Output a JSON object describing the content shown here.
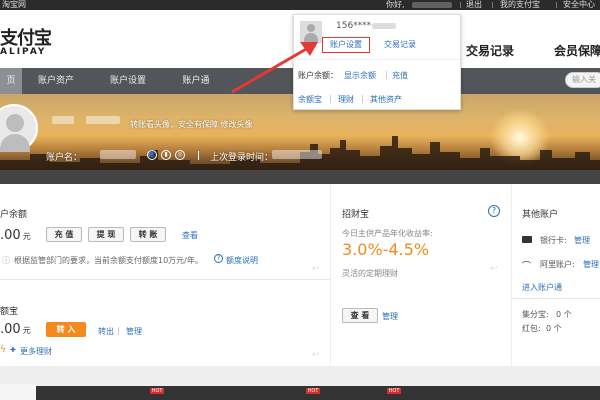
{
  "topbar": {
    "left": "淘宝网",
    "greeting": "你好,",
    "logout": "退出",
    "my_alipay": "我的支付宝",
    "security_center": "安全中心"
  },
  "header": {
    "logo": "支付宝",
    "logo_sub": "ALIPAY",
    "nav_transactions": "交易记录",
    "nav_member": "会员保障"
  },
  "tabs": [
    {
      "label": "页",
      "active": true
    },
    {
      "label": "账户资产"
    },
    {
      "label": "账户设置"
    },
    {
      "label": "账户通"
    }
  ],
  "search": {
    "placeholder": "输入关"
  },
  "banner": {
    "avatar_hint": "转账看头像，安全有保障 修改头像",
    "account_name_label": "账户名：",
    "last_login_label": "上次登录时间："
  },
  "popup": {
    "account": "156****",
    "settings": "账户设置",
    "records": "交易记录",
    "balance_label": "账户余额：",
    "show_balance": "显示余额",
    "recharge": "充值",
    "yuebao": "余额宝",
    "licai": "理财",
    "other_assets": "其他资产"
  },
  "balance_card": {
    "title": "户余额",
    "amount": ".00",
    "unit": "元",
    "btn_recharge": "充 值",
    "btn_withdraw": "提 现",
    "btn_transfer": "转 账",
    "view": "查看",
    "note": "根据监管部门的要求，当前余额支付额度10万元/年。",
    "quota_link": "额度说明"
  },
  "yuebao_card": {
    "title": "额宝",
    "amount": ".00",
    "unit": "元",
    "btn_in": "转 入",
    "out": "转出",
    "manage": "管理",
    "more": "更多理财"
  },
  "zhaocaibao": {
    "title": "招财宝",
    "help": "?",
    "subtitle": "今日主供产品年化收益率:",
    "rate": "3.0%-4.5%",
    "desc": "灵活的定期理财",
    "view_btn": "查 看",
    "manage": "管理"
  },
  "other_accounts": {
    "title": "其他账户",
    "bank_label": "银行卡:",
    "bank_manage": "管理",
    "ali_label": "阿里账户:",
    "ali_manage": "管理",
    "enter": "进入账户通",
    "jifen_label": "集分宝:",
    "jifen_value": "0 个",
    "hongbao_label": "红包:",
    "hongbao_value": "0 个"
  },
  "bottom": {
    "hot": "HOT"
  },
  "colors": {
    "accent_orange": "#f28a1e",
    "link_blue": "#2a6fb8",
    "highlight_red": "#e53935"
  }
}
